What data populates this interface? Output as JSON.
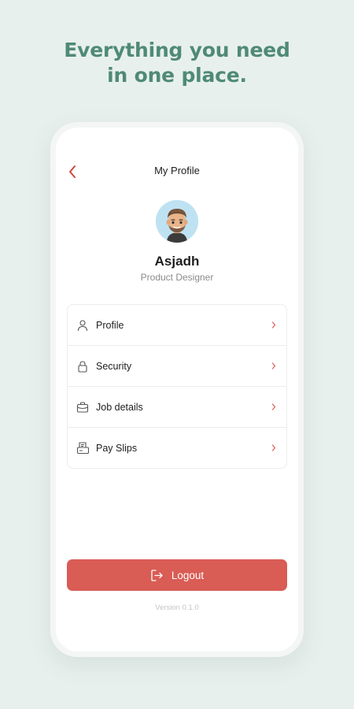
{
  "headline": {
    "line1": "Everything you need",
    "line2": "in one place."
  },
  "header": {
    "title": "My Profile"
  },
  "profile": {
    "name": "Asjadh",
    "role": "Product Designer"
  },
  "menu": {
    "items": [
      {
        "label": "Profile",
        "icon": "user-icon"
      },
      {
        "label": "Security",
        "icon": "lock-icon"
      },
      {
        "label": "Job details",
        "icon": "briefcase-icon"
      },
      {
        "label": "Pay Slips",
        "icon": "payslip-icon"
      }
    ]
  },
  "logout": {
    "label": "Logout"
  },
  "footer": {
    "version": "Version 0.1.0"
  },
  "colors": {
    "background": "#e8f0ed",
    "headline": "#4f8a77",
    "accent": "#d95c55",
    "avatar_bg": "#bfe2f2"
  }
}
